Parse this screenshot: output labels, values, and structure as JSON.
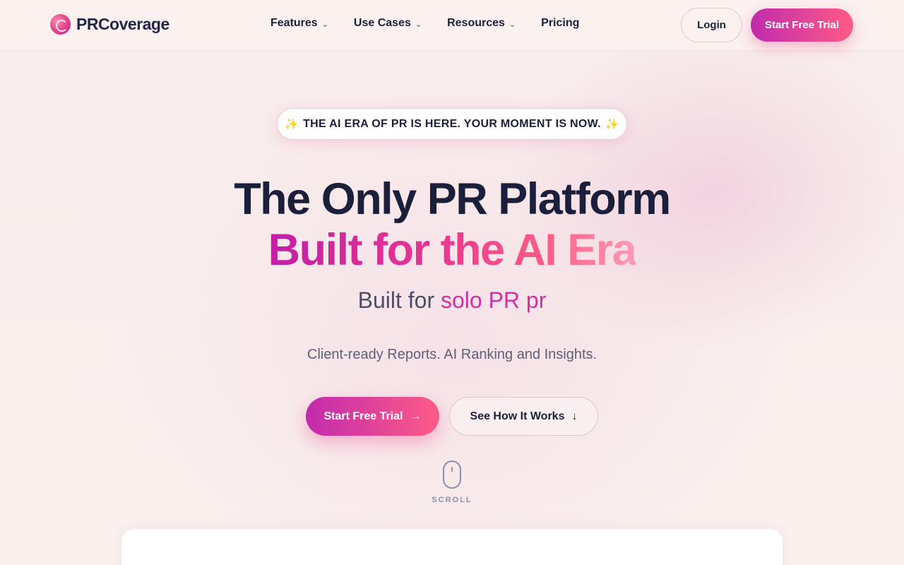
{
  "brand": {
    "name": "PRCoverage"
  },
  "nav": {
    "items": [
      {
        "label": "Features",
        "has_dropdown": true
      },
      {
        "label": "Use Cases",
        "has_dropdown": true
      },
      {
        "label": "Resources",
        "has_dropdown": true
      },
      {
        "label": "Pricing",
        "has_dropdown": false
      }
    ],
    "login_label": "Login",
    "trial_label": "Start Free Trial"
  },
  "hero": {
    "badge_text": "THE AI ERA OF PR IS HERE. YOUR MOMENT IS NOW.",
    "badge_icon": "sparkles-icon",
    "title_line1": "The Only PR Platform",
    "title_line2": "Built for the AI Era",
    "subtitle_prefix": "Built for",
    "subtitle_accent": "solo PR pr",
    "description": "Client-ready Reports. AI Ranking and Insights.",
    "primary_cta": "Start Free Trial",
    "secondary_cta": "See How It Works",
    "scroll_label": "SCROLL"
  },
  "colors": {
    "accent_start": "#c12bac",
    "accent_end": "#ff5b86",
    "text_dark": "#1b1f3b",
    "background": "#faf1ee"
  }
}
